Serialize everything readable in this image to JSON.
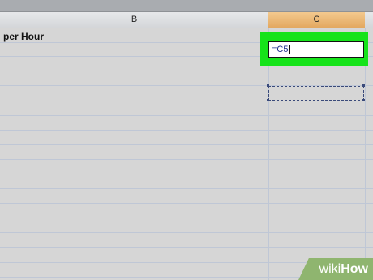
{
  "columns": [
    {
      "label": "B",
      "selected": false
    },
    {
      "label": "C",
      "selected": true
    }
  ],
  "cells": {
    "b_header_text": "per Hour",
    "c5_formula": "=C5"
  },
  "colors": {
    "highlight": "#16e31a",
    "selected_column": "#e3a860"
  },
  "watermark": {
    "part1": "wiki",
    "part2": "How"
  }
}
